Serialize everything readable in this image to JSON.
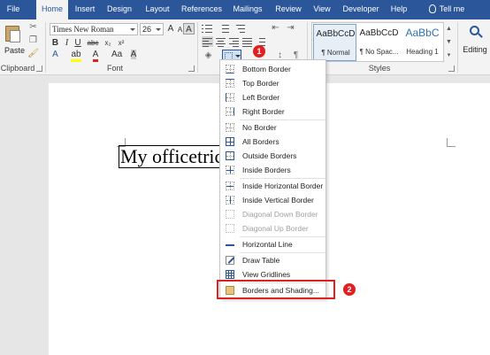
{
  "tabs": [
    "File",
    "Home",
    "Insert",
    "Design",
    "Layout",
    "References",
    "Mailings",
    "Review",
    "View",
    "Developer",
    "Help",
    "Tell me"
  ],
  "active_tab": "Home",
  "clipboard": {
    "paste_label": "Paste",
    "group_label": "Clipboard"
  },
  "font": {
    "name": "Times New Roman",
    "size": "26",
    "group_label": "Font"
  },
  "styles": {
    "group_label": "Styles",
    "items": [
      {
        "preview": "AaBbCcD",
        "name": "¶ Normal"
      },
      {
        "preview": "AaBbCcD",
        "name": "¶ No Spac..."
      },
      {
        "preview": "AaBbC",
        "name": "Heading 1"
      }
    ]
  },
  "editing": {
    "label": "Editing"
  },
  "document": {
    "text": "My officetricks"
  },
  "border_menu": {
    "items": [
      {
        "label": "Bottom Border",
        "icon": "bottom-border-icon",
        "enabled": true
      },
      {
        "label": "Top Border",
        "icon": "top-border-icon",
        "enabled": true
      },
      {
        "label": "Left Border",
        "icon": "left-border-icon",
        "enabled": true
      },
      {
        "label": "Right Border",
        "icon": "right-border-icon",
        "enabled": true
      },
      {
        "label": "No Border",
        "icon": "no-border-icon",
        "enabled": true
      },
      {
        "label": "All Borders",
        "icon": "all-borders-icon",
        "enabled": true
      },
      {
        "label": "Outside Borders",
        "icon": "outside-borders-icon",
        "enabled": true
      },
      {
        "label": "Inside Borders",
        "icon": "inside-borders-icon",
        "enabled": true
      },
      {
        "label": "Inside Horizontal Border",
        "icon": "inside-horizontal-border-icon",
        "enabled": true
      },
      {
        "label": "Inside Vertical Border",
        "icon": "inside-vertical-border-icon",
        "enabled": true
      },
      {
        "label": "Diagonal Down Border",
        "icon": "diagonal-down-border-icon",
        "enabled": false
      },
      {
        "label": "Diagonal Up Border",
        "icon": "diagonal-up-border-icon",
        "enabled": false
      },
      {
        "label": "Horizontal Line",
        "icon": "horizontal-line-icon",
        "enabled": true
      },
      {
        "label": "Draw Table",
        "icon": "draw-table-icon",
        "enabled": true
      },
      {
        "label": "View Gridlines",
        "icon": "view-gridlines-icon",
        "enabled": true
      },
      {
        "label": "Borders and Shading...",
        "icon": "borders-shading-icon",
        "enabled": true
      }
    ]
  },
  "callouts": {
    "one": "1",
    "two": "2"
  },
  "colors": {
    "accent": "#2b579a",
    "callout": "#e02020"
  }
}
